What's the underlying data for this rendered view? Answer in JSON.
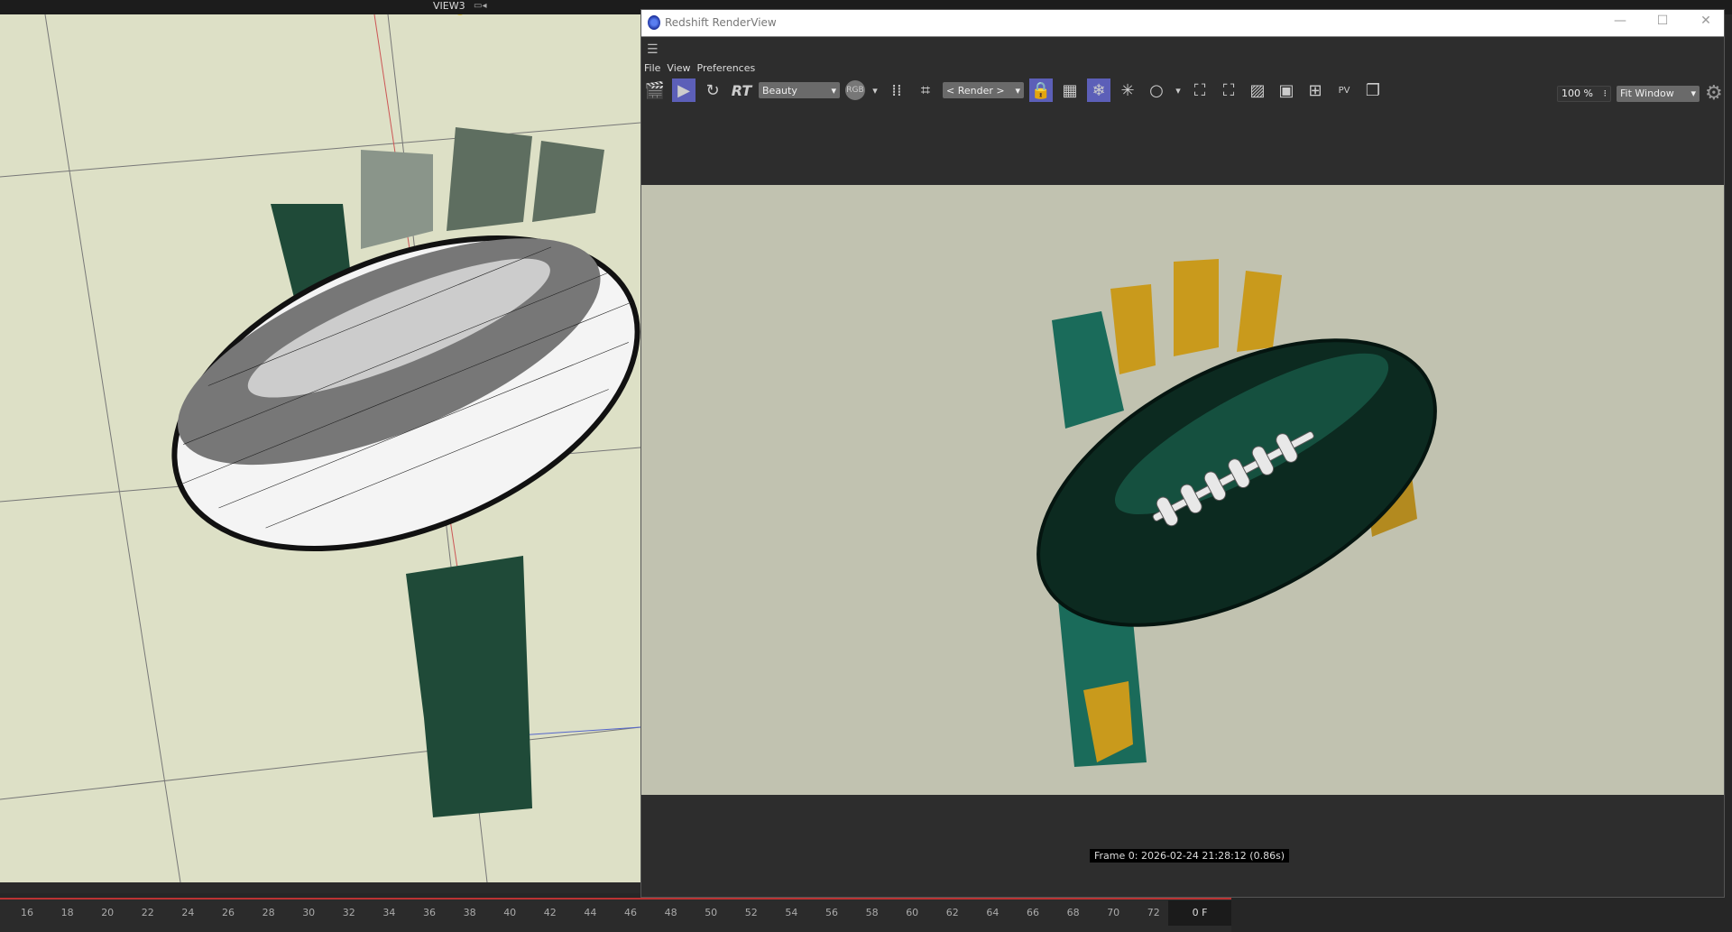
{
  "viewport": {
    "label": "VIEW3",
    "camera_icon": "camera-icon"
  },
  "renderview": {
    "title": "Redshift RenderView",
    "window_controls": {
      "minimize": "—",
      "maximize": "☐",
      "close": "✕"
    },
    "menu": [
      "File",
      "View",
      "Preferences"
    ],
    "toolbar": {
      "rt_label": "RT",
      "aov_select": "Beauty",
      "rgb_label": "RGB",
      "camera_select": "< Render >",
      "pv_label": "PV",
      "zoom_value": "100 %",
      "fit_select": "Fit Window"
    },
    "frame_info": "Frame  0:  2026-02-24  21:28:12  (0.86s)"
  },
  "timeline": {
    "ticks": [
      "16",
      "18",
      "20",
      "22",
      "24",
      "26",
      "28",
      "30",
      "32",
      "34",
      "36",
      "38",
      "40",
      "42",
      "44",
      "46",
      "48",
      "50",
      "52",
      "54",
      "56",
      "58",
      "60",
      "62",
      "64",
      "66",
      "68",
      "70",
      "72"
    ],
    "current_frame": "0 F"
  },
  "colors": {
    "accent": "#5c5fb8",
    "viewport_bg": "#dde0c6",
    "render_bg": "#c1c2b0",
    "ball": "#0c2a20",
    "glove_teal": "#1a6b5a",
    "glove_yellow": "#c99a1c"
  }
}
